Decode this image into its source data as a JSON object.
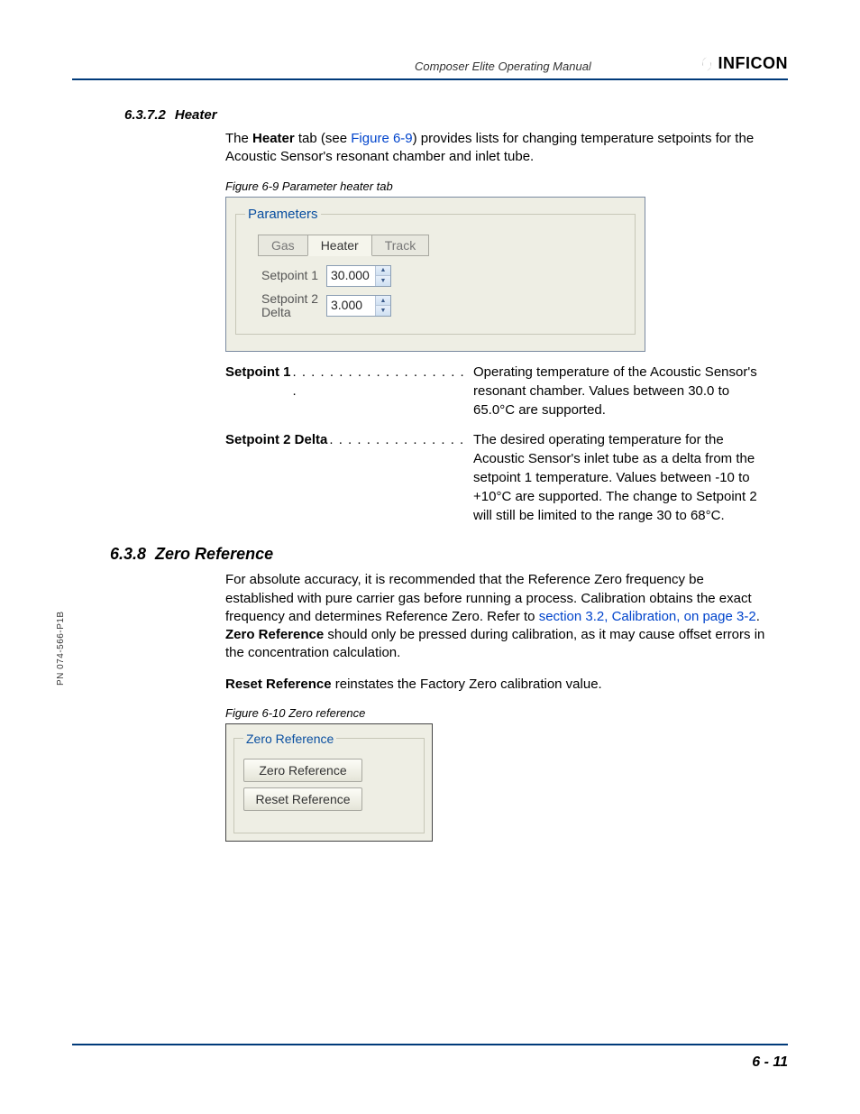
{
  "header": {
    "manual_title": "Composer Elite Operating Manual",
    "logo_text": "INFICON"
  },
  "side_pn": "PN 074-566-P1B",
  "sec_6_3_7_2": {
    "num": "6.3.7.2",
    "title": "Heater",
    "para_pre": "The ",
    "para_b": "Heater",
    "para_mid": " tab (see ",
    "para_link": "Figure 6-9",
    "para_post": ") provides lists for changing temperature setpoints for the Acoustic Sensor's resonant chamber and inlet tube."
  },
  "fig_6_9": {
    "caption": "Figure 6-9  Parameter heater tab",
    "panel_title": "Parameters",
    "tabs": {
      "gas": "Gas",
      "heater": "Heater",
      "track": "Track"
    },
    "setpoint1_label": "Setpoint 1",
    "setpoint1_value": "30.000",
    "setpoint2_label": "Setpoint 2 Delta",
    "setpoint2_value": "3.000"
  },
  "defs": {
    "sp1_term": "Setpoint 1",
    "sp1_dots": " . . . . . . . . . . . . . . . . . . . . ",
    "sp1_desc": "Operating temperature of the Acoustic Sensor's resonant chamber. Values between 30.0 to 65.0°C are supported.",
    "sp2_term": "Setpoint 2 Delta",
    "sp2_dots": " . . . . . . . . . . . . . . . ",
    "sp2_desc": "The desired operating temperature for the Acoustic Sensor's inlet tube as a delta from the setpoint 1 temperature. Values between -10 to +10°C are supported. The change to Setpoint 2 will still be limited to the range 30 to 68°C."
  },
  "sec_6_3_8": {
    "num": "6.3.8",
    "title": "Zero Reference",
    "para1_a": "For absolute accuracy, it is recommended that the Reference Zero frequency be established with pure carrier gas before running a process. Calibration obtains the exact frequency and determines Reference Zero. Refer to ",
    "para1_link": "section 3.2, Calibration, on page 3-2",
    "para1_b": ". ",
    "para1_bold": "Zero Reference",
    "para1_c": " should only be pressed during calibration, as it may cause offset errors in the concentration calculation.",
    "para2_bold": "Reset Reference",
    "para2_rest": " reinstates the Factory Zero calibration value."
  },
  "fig_6_10": {
    "caption": "Figure 6-10  Zero reference",
    "panel_title": "Zero Reference",
    "btn_zero": "Zero Reference",
    "btn_reset": "Reset Reference"
  },
  "footer": {
    "page": "6 - 11"
  }
}
